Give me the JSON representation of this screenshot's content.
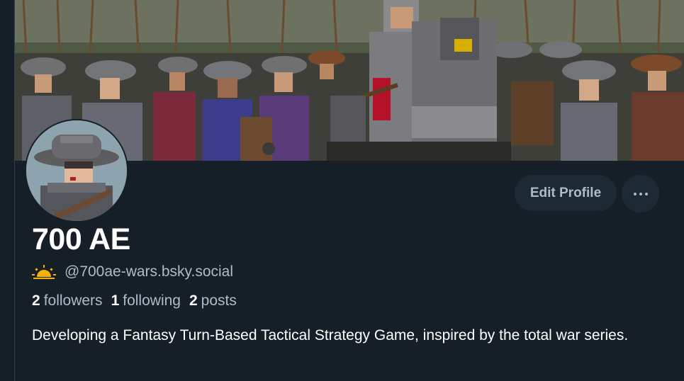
{
  "profile": {
    "display_name": "700 AE",
    "handle": "@700ae-wars.bsky.social",
    "handle_icon": "sun-icon",
    "bio": "Developing a Fantasy Turn-Based Tactical Strategy Game, inspired by the total war series."
  },
  "stats": {
    "followers_count": "2",
    "followers_label": "followers",
    "following_count": "1",
    "following_label": "following",
    "posts_count": "2",
    "posts_label": "posts"
  },
  "actions": {
    "edit_profile_label": "Edit Profile",
    "more_icon": "more-horizontal-icon"
  },
  "colors": {
    "background": "#161e27",
    "button_bg": "#1e2936",
    "muted_text": "#aebbc9",
    "accent_sun": "#f5b301"
  }
}
